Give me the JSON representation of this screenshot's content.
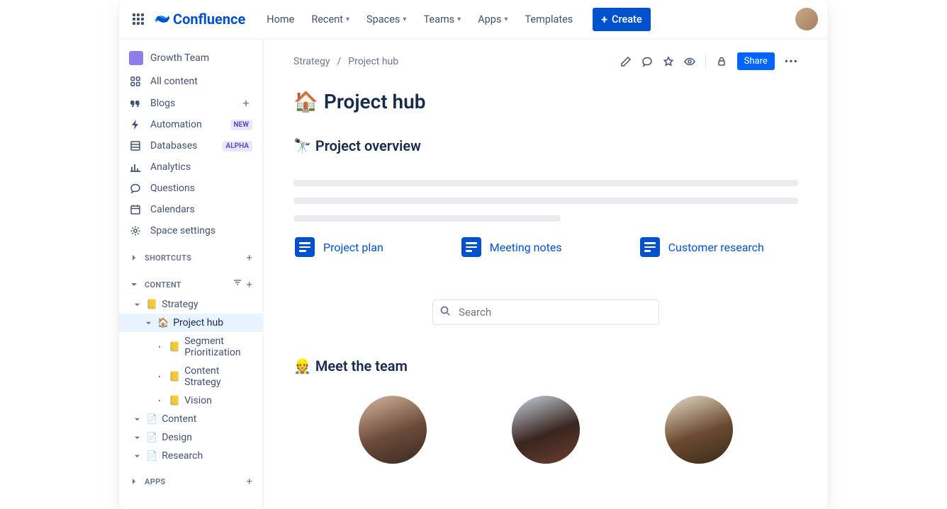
{
  "brand": "Confluence",
  "nav": {
    "home": "Home",
    "recent": "Recent",
    "spaces": "Spaces",
    "teams": "Teams",
    "apps": "Apps",
    "templates": "Templates",
    "create": "Create"
  },
  "space": {
    "name": "Growth Team"
  },
  "sidebar": {
    "allContent": "All content",
    "blogs": "Blogs",
    "automation": "Automation",
    "automationBadge": "NEW",
    "databases": "Databases",
    "databasesBadge": "ALPHA",
    "analytics": "Analytics",
    "questions": "Questions",
    "calendars": "Calendars",
    "spaceSettings": "Space settings",
    "shortcuts": "SHORTCUTS",
    "content": "CONTENT",
    "apps": "APPS"
  },
  "tree": {
    "strategy": "Strategy",
    "projectHub": "Project hub",
    "segment": "Segment Prioritization",
    "contentStrategy": "Content Strategy",
    "vision": "Vision",
    "contentPage": "Content",
    "design": "Design",
    "research": "Research"
  },
  "breadcrumb": {
    "parent": "Strategy",
    "current": "Project hub"
  },
  "actions": {
    "share": "Share"
  },
  "page": {
    "titleEmoji": "🏠",
    "title": "Project hub",
    "overviewEmoji": "🔭",
    "overview": "Project overview",
    "teamEmoji": "👷",
    "team": "Meet the team"
  },
  "docLinks": {
    "plan": "Project plan",
    "notes": "Meeting notes",
    "research": "Customer research"
  },
  "search": {
    "placeholder": "Search"
  }
}
